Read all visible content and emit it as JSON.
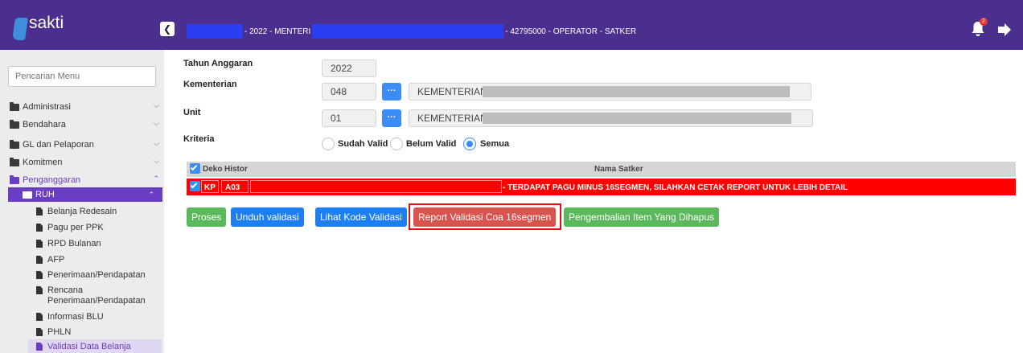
{
  "app": {
    "logo_text": "sakti"
  },
  "header": {
    "info_segment_1": "- 2022 - MENTERI",
    "info_segment_2": "- 42795000 - OPERATOR - SATKER",
    "notification_count": "2"
  },
  "sidebar": {
    "search_placeholder": "Pencarian Menu",
    "menu": [
      {
        "label": "Administrasi"
      },
      {
        "label": "Bendahara"
      },
      {
        "label": "GL dan Pelaporan"
      },
      {
        "label": "Komitmen"
      },
      {
        "label": "Penganggaran"
      }
    ],
    "ruh_label": "RUH",
    "sub_items": [
      {
        "label": "Belanja Redesain"
      },
      {
        "label": "Pagu per PPK"
      },
      {
        "label": "RPD Bulanan"
      },
      {
        "label": "AFP"
      },
      {
        "label": "Penerimaan/Pendapatan"
      },
      {
        "label": "Rencana Penerimaan/Pendapatan"
      },
      {
        "label": "Informasi BLU"
      },
      {
        "label": "PHLN"
      },
      {
        "label": "Validasi Data Belanja"
      }
    ]
  },
  "form": {
    "tahun_label": "Tahun Anggaran",
    "tahun_value": "2022",
    "kementerian_label": "Kementerian",
    "kementerian_code": "048",
    "kementerian_name": "KEMENTERIAN",
    "unit_label": "Unit",
    "unit_code": "01",
    "unit_name": "KEMENTERIAN",
    "kriteria_label": "Kriteria",
    "options": [
      "Sudah Valid",
      "Belum Valid",
      "Semua"
    ],
    "selected_option": "Semua",
    "dots_label": "···"
  },
  "table": {
    "headers": [
      "Deko",
      "Histor",
      "Nama Satker"
    ],
    "row": {
      "kode": "KP",
      "histor": "A03",
      "message": "- TERDAPAT PAGU MINUS 16SEGMEN, SILAHKAN CETAK REPORT UNTUK LEBIH DETAIL"
    }
  },
  "buttons": {
    "proses": "Proses",
    "unduh": "Unduh validasi",
    "lihat": "Lihat Kode Validasi",
    "report": "Report Validasi Coa 16segmen",
    "pengembalian": "Pengembalian Item Yang Dihapus"
  },
  "colors": {
    "topbar": "#4b2f8e",
    "accent": "#6a3ec2",
    "error_row": "#ff0000",
    "primary_blue": "#1e7ff5",
    "success_green": "#5cb85c",
    "danger_red": "#d9534f"
  }
}
